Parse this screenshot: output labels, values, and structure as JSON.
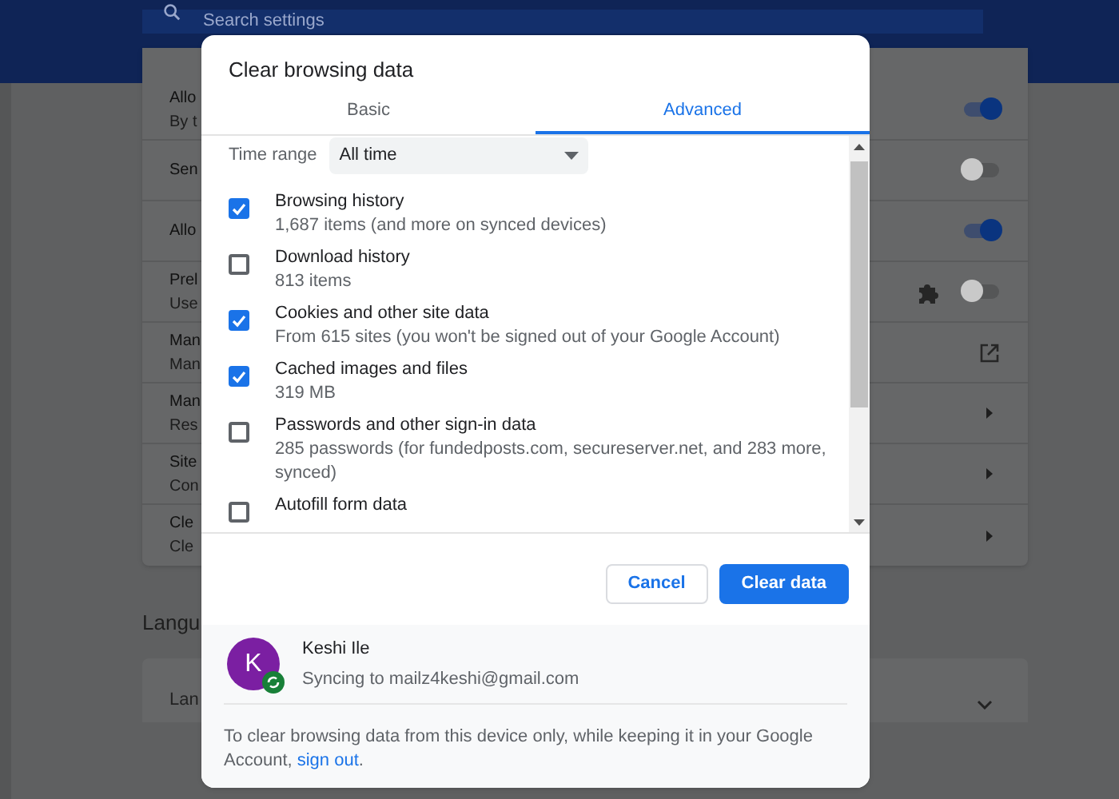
{
  "settings_header": {
    "search_placeholder": "Search settings"
  },
  "settings_rows": [
    {
      "title": "Allo",
      "subtitle": "By t",
      "kind": "toggle",
      "on": true
    },
    {
      "title": "Sen",
      "kind": "toggle",
      "on": false
    },
    {
      "title": "Allo",
      "kind": "toggle",
      "on": true
    },
    {
      "title": "Prel",
      "subtitle": "Use",
      "kind": "extension_toggle",
      "on": false
    },
    {
      "title": "Man",
      "subtitle": "Man",
      "kind": "external"
    },
    {
      "title": "Man",
      "subtitle": "Res",
      "kind": "arrow"
    },
    {
      "title": "Site",
      "subtitle": "Con",
      "kind": "arrow"
    },
    {
      "title": "Cle",
      "subtitle": "Cle",
      "kind": "arrow"
    }
  ],
  "section_heading": "Langu",
  "languages_row": {
    "title": "Lan"
  },
  "dialog": {
    "title": "Clear browsing data",
    "tabs": [
      {
        "label": "Basic",
        "selected": false
      },
      {
        "label": "Advanced",
        "selected": true
      }
    ],
    "time_range": {
      "label": "Time range",
      "value": "All time"
    },
    "items": [
      {
        "label": "Browsing history",
        "detail": "1,687 items (and more on synced devices)",
        "checked": true
      },
      {
        "label": "Download history",
        "detail": "813 items",
        "checked": false
      },
      {
        "label": "Cookies and other site data",
        "detail": "From 615 sites (you won't be signed out of your Google Account)",
        "checked": true
      },
      {
        "label": "Cached images and files",
        "detail": "319 MB",
        "checked": true
      },
      {
        "label": "Passwords and other sign-in data",
        "detail": "285 passwords (for fundedposts.com, secureserver.net, and 283 more, synced)",
        "checked": false
      },
      {
        "label": "Autofill form data",
        "checked": false
      }
    ],
    "buttons": [
      {
        "label": "Cancel",
        "kind": "secondary"
      },
      {
        "label": "Clear data",
        "kind": "primary"
      }
    ],
    "account": {
      "initial": "K",
      "name": "Keshi Ile",
      "sync_status": "Syncing to mailz4keshi@gmail.com"
    },
    "note": {
      "text": "To clear browsing data from this device only, while keeping it in your Google Account, ",
      "link": "sign out",
      "end": "."
    }
  }
}
